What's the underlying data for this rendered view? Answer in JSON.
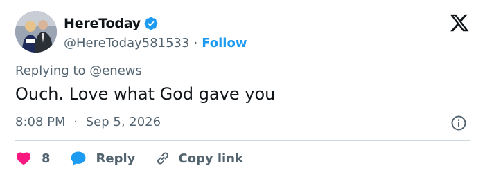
{
  "user": {
    "display_name": "HereToday",
    "handle": "@HereToday581533",
    "separator": "·",
    "follow_label": "Follow",
    "verified_icon": "verified-badge-icon",
    "verified_color": "#1d9bf0"
  },
  "tweet": {
    "replying_to_prefix": "Replying to",
    "replying_to_handle": "@enews",
    "text": "Ouch. Love what God gave you",
    "time": "8:08 PM",
    "separator": "·",
    "date": "Sep 5, 2026"
  },
  "actions": {
    "like_count": "8",
    "reply_label": "Reply",
    "copy_link_label": "Copy link"
  },
  "colors": {
    "like": "#f91880",
    "reply": "#1d9bf0",
    "secondary_text": "#536471",
    "primary_text": "#0f1419",
    "divider": "#cfd9de"
  },
  "icons": {
    "platform": "x-logo-icon",
    "info": "info-icon",
    "like": "heart-icon",
    "reply": "speech-bubble-icon",
    "copy_link": "link-icon"
  }
}
